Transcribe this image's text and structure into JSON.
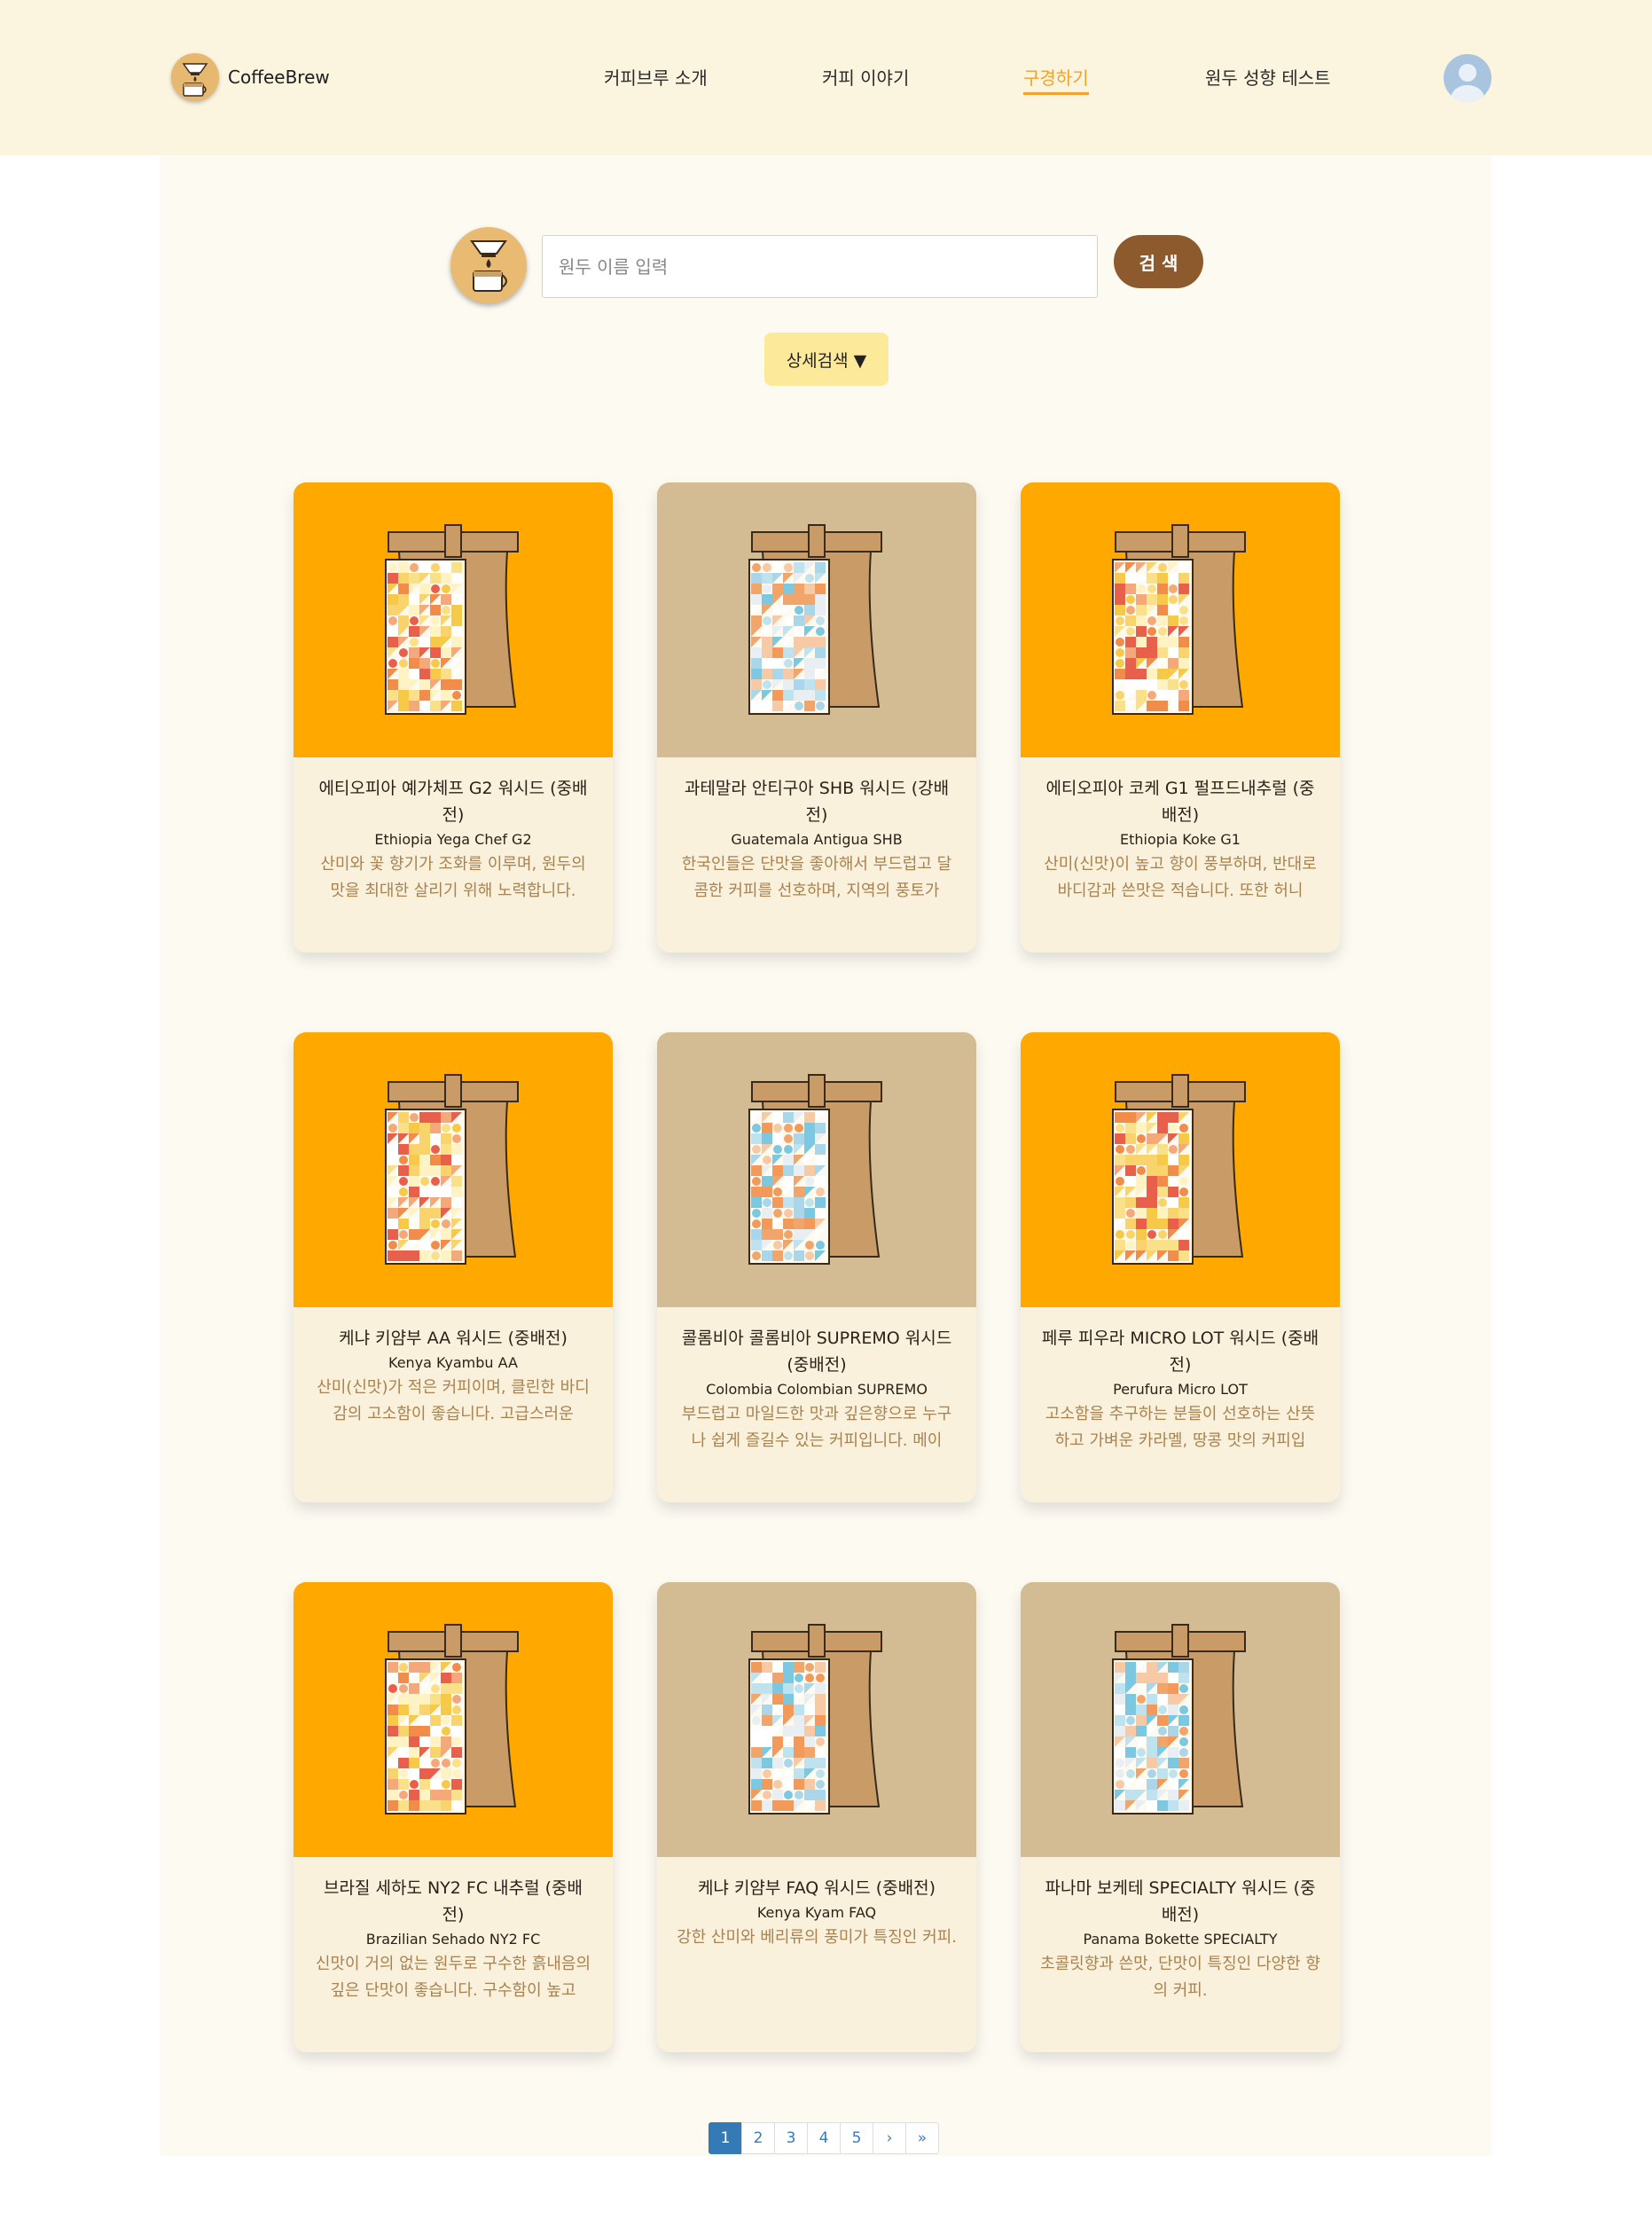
{
  "header": {
    "brand": "CoffeeBrew",
    "nav": [
      {
        "label": "커피브루 소개",
        "active": false
      },
      {
        "label": "커피 이야기",
        "active": false
      },
      {
        "label": "구경하기",
        "active": true
      },
      {
        "label": "원두 성향 테스트",
        "active": false
      }
    ]
  },
  "search": {
    "placeholder": "원두 이름 입력",
    "value": "",
    "button_label": "검 색",
    "advanced_label": "상세검색 ▼"
  },
  "colors": {
    "header_bg": "#fbf4df",
    "accent": "#f2a12b",
    "search_button": "#8c5a2c",
    "advanced_button": "#fde99a",
    "card_orange": "#ffa800",
    "card_tan": "#d3bc94",
    "card_body": "#f9f1dc",
    "description_text": "#a88250",
    "pagination_active": "#337ab7"
  },
  "products": [
    {
      "name": "에티오피아 예가체프 G2 워시드 (중배전)",
      "english": "Ethiopia Yega Chef G2",
      "description": "산미와 꽃 향기가 조화를 이루며, 원두의 맛을 최대한 살리기 위해 노력합니다.",
      "bg": "orange"
    },
    {
      "name": "과테말라 안티구아 SHB 워시드 (강배전)",
      "english": "Guatemala Antigua SHB",
      "description": "한국인들은 단맛을 좋아해서 부드럽고 달콤한 커피를 선호하며, 지역의 풍토가",
      "bg": "tan"
    },
    {
      "name": "에티오피아 코케 G1 펄프드내추럴 (중배전)",
      "english": "Ethiopia Koke G1",
      "description": "산미(신맛)이 높고 향이 풍부하며, 반대로 바디감과 쓴맛은 적습니다. 또한 허니",
      "bg": "orange"
    },
    {
      "name": "케냐 키얌부 AA 워시드 (중배전)",
      "english": "Kenya Kyambu AA",
      "description": "산미(신맛)가 적은 커피이며, 클린한 바디감의 고소함이 좋습니다. 고급스러운",
      "bg": "orange"
    },
    {
      "name": "콜롬비아 콜롬비아 SUPREMO 워시드 (중배전)",
      "english": "Colombia Colombian SUPREMO",
      "description": "부드럽고 마일드한 맛과 깊은향으로 누구나 쉽게 즐길수 있는 커피입니다. 메이",
      "bg": "tan"
    },
    {
      "name": "페루 피우라 MICRO LOT 워시드 (중배전)",
      "english": "Perufura Micro LOT",
      "description": "고소함을 추구하는 분들이 선호하는 산뜻하고 가벼운 카라멜, 땅콩 맛의 커피입",
      "bg": "orange"
    },
    {
      "name": "브라질 세하도 NY2 FC 내추럴 (중배전)",
      "english": "Brazilian Sehado NY2 FC",
      "description": "신맛이 거의 없는 원두로 구수한 흙내음의 깊은 단맛이 좋습니다. 구수함이 높고",
      "bg": "orange"
    },
    {
      "name": "케냐 키얌부 FAQ 워시드 (중배전)",
      "english": "Kenya Kyam FAQ",
      "description": "강한 산미와 베리류의 풍미가 특징인 커피.",
      "bg": "tan"
    },
    {
      "name": "파나마 보케테 SPECIALTY 워시드 (중배전)",
      "english": "Panama Bokette SPECIALTY",
      "description": "초콜릿향과 쓴맛, 단맛이 특징인 다양한 향의 커피.",
      "bg": "tan"
    }
  ],
  "pagination": {
    "pages": [
      "1",
      "2",
      "3",
      "4",
      "5"
    ],
    "current": "1",
    "next": "›",
    "last": "»"
  }
}
